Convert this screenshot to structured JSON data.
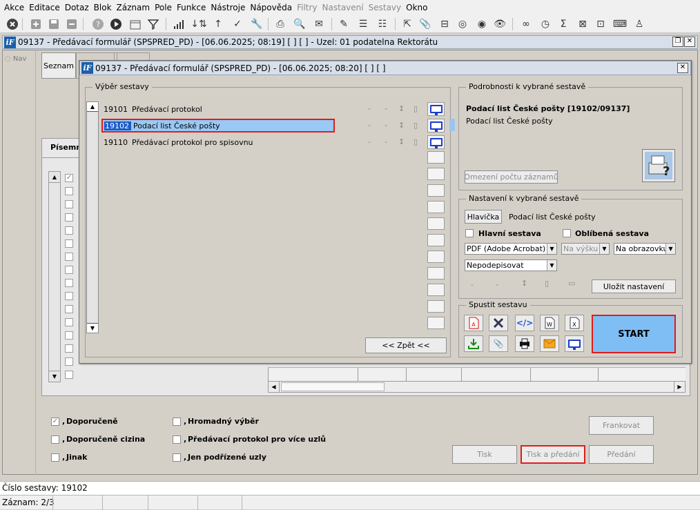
{
  "menu": [
    "Akce",
    "Editace",
    "Dotaz",
    "Blok",
    "Záznam",
    "Pole",
    "Funkce",
    "Nástroje",
    "Nápověda",
    "Filtry",
    "Nastavení",
    "Sestavy",
    "Okno"
  ],
  "menu_disabled": [
    "Filtry",
    "Nastavení",
    "Sestavy"
  ],
  "outer_window": {
    "title": "09137 - Předávací formulář (SPSPRED_PD) - [06.06.2025; 08:19]  [ ]  [ ] - Uzel: 01 podatelna Rektorátu",
    "logo": "iF",
    "nav_radio": "Nav",
    "seznam_tab": "Seznam",
    "pisemn_tab": "Písemn"
  },
  "dialog": {
    "title": "09137 - Předávací formulář (SPSPRED_PD) - [06.06.2025; 08:20]  [ ]  [ ]",
    "logo": "iF",
    "vyber_legend": "Výběr sestavy",
    "reports": [
      {
        "code": "19101",
        "name": "Předávací protokol",
        "selected": false
      },
      {
        "code": "19102",
        "name": "Podací list České pošty",
        "selected": true
      },
      {
        "code": "19110",
        "name": "Předávací protokol pro spisovnu",
        "selected": false
      }
    ],
    "back_button": "<< Zpět <<",
    "details": {
      "legend": "Podrobnosti k vybrané sestavě",
      "title": "Podací list České pošty [19102/09137]",
      "desc": "Podací list České pošty",
      "limit_button": "Omezení počtu záznamů"
    },
    "settings": {
      "legend": "Nastavení k vybrané sestavě",
      "header_button": "Hlavička",
      "header_value": "Podací list České pošty",
      "main_report": "Hlavní sestava",
      "favorite_report": "Oblíbená sestava",
      "format_value": "PDF (Adobe Acrobat)",
      "orientation_value": "Na výšku",
      "output_value": "Na obrazovku",
      "sign_value": "Nepodepisovat",
      "save_button": "Uložit nastavení"
    },
    "run": {
      "legend": "Spustit sestavu",
      "start_button": "START"
    }
  },
  "bottom": {
    "checks": [
      {
        "label": "Doporučeně",
        "checked": true
      },
      {
        "label": "Doporučeně cizina",
        "checked": false
      },
      {
        "label": "Jinak",
        "checked": false
      },
      {
        "label": "Hromadný výběr",
        "checked": false
      },
      {
        "label": "Předávací protokol pro více uzlů",
        "checked": false
      },
      {
        "label": "Jen podřízené uzly",
        "checked": false
      }
    ],
    "frankovat": "Frankovat",
    "tisk": "Tisk",
    "tisk_predani": "Tisk a předání",
    "predani": "Předání"
  },
  "status": {
    "cislo_sestavy": "Číslo sestavy: 19102",
    "zaznam": "Záznam: 2/3"
  }
}
